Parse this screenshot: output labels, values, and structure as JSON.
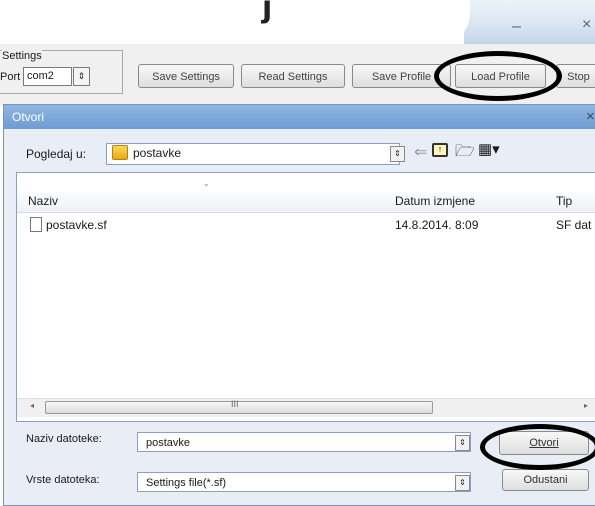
{
  "app": {
    "title_glyph": "j",
    "minimize_glyph": "–",
    "close_glyph": "×"
  },
  "settings": {
    "group_label": "Settings",
    "port_label": "Port",
    "port_value": "com2",
    "spinner_glyph": "⇕",
    "buttons": {
      "save_settings": "Save Settings",
      "read_settings": "Read Settings",
      "save_profile": "Save Profile",
      "load_profile": "Load Profile",
      "stop": "Stop"
    }
  },
  "dialog": {
    "title": "Otvori",
    "close_glyph": "×",
    "look_in_label": "Pogledaj u:",
    "look_in_value": "postavke",
    "dropdown_glyph": "⇕",
    "toolbar": {
      "back": "⇐",
      "up": "↑",
      "new_folder": "🗁",
      "views": "▦▾"
    },
    "columns": {
      "name": "Naziv",
      "date": "Datum izmjene",
      "type": "Tip"
    },
    "sort_glyph": "⌄",
    "files": [
      {
        "name": "postavke.sf",
        "date": "14.8.2014. 8:09",
        "type": "SF dat"
      }
    ],
    "scrollbar": {
      "left": "◂",
      "grip": "III",
      "right": "▸"
    },
    "filename_label": "Naziv datoteke:",
    "filename_value": "postavke",
    "filetype_label": "Vrste datoteka:",
    "filetype_value": "Settings file(*.sf)",
    "open_button": "Otvori",
    "cancel_button": "Odustani"
  },
  "colors": {
    "dialog_title_bar": "#7aa5da",
    "annotation_ring": "#000000"
  }
}
